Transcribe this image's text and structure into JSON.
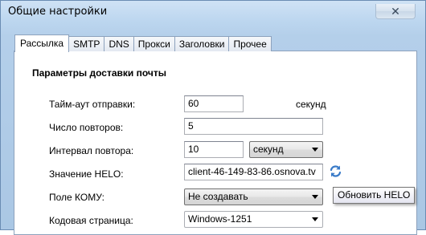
{
  "window": {
    "title": "Общие настройки",
    "close_glyph": "✕"
  },
  "tabs": [
    {
      "label": "Рассылка",
      "active": true
    },
    {
      "label": "SMTP"
    },
    {
      "label": "DNS"
    },
    {
      "label": "Прокси"
    },
    {
      "label": "Заголовки"
    },
    {
      "label": "Прочее"
    }
  ],
  "section": {
    "title": "Параметры доставки почты"
  },
  "fields": {
    "timeout": {
      "label": "Тайм-аут отправки:",
      "value": "60",
      "unit": "секунд"
    },
    "retries": {
      "label": "Число повторов:",
      "value": "5"
    },
    "interval": {
      "label": "Интервал повтора:",
      "value": "10",
      "unit_selected": "секунд"
    },
    "helo": {
      "label": "Значение HELO:",
      "value": "client-46-149-83-86.osnova.tv"
    },
    "to_field": {
      "label": "Поле КОМУ:",
      "selected": "Не создавать"
    },
    "codepage": {
      "label": "Кодовая страница:",
      "selected": "Windows-1251"
    }
  },
  "tooltip": {
    "text": "Обновить HELO"
  },
  "icons": {
    "refresh": "refresh-icon"
  }
}
